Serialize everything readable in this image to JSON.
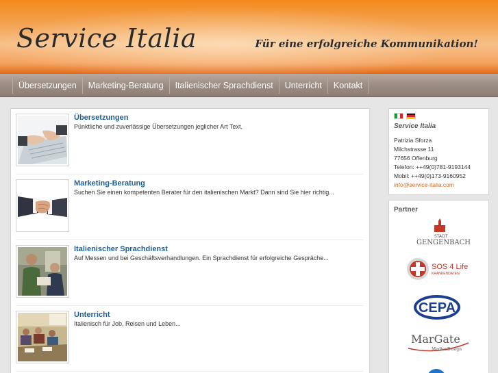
{
  "header": {
    "title": "Service Italia",
    "tagline": "Für eine erfolgreiche Kommunikation!"
  },
  "nav": {
    "items": [
      "Übersetzungen",
      "Marketing-Beratung",
      "Italienischer Sprachdienst",
      "Unterricht",
      "Kontakt"
    ]
  },
  "services": [
    {
      "title": "Übersetzungen",
      "description": "Pünktliche und zuverlässige Übersetzungen  jeglicher Art Text.",
      "image": "typing-hands-photo"
    },
    {
      "title": "Marketing-Beratung",
      "description": "Suchen Sie einen kompetenten Berater für den italienischen Markt? Dann sind Sie hier richtig...",
      "image": "handshake-photo"
    },
    {
      "title": "Italienischer Sprachdienst",
      "description": "Auf Messen und bei Geschäftsverhandlungen. Ein Sprachdienst für erfolgreiche Gespräche...",
      "image": "conversation-photo"
    },
    {
      "title": "Unterricht",
      "description": "Italienisch für Job, Reisen und Leben...",
      "image": "classroom-photo"
    }
  ],
  "contact": {
    "flags": [
      "italy-flag",
      "germany-flag"
    ],
    "title": "Service Italia",
    "name": "Patrizia Sforza",
    "street": "Milchstrasse 11",
    "city": "77656 Offenburg",
    "phone": "Telefon: ++49(0)781-9193144",
    "mobile": "Mobil: ++49(0)173-9160952",
    "email": "info@service-italia.com"
  },
  "partners": {
    "title": "Partner",
    "logos": [
      {
        "top_text": "STADT",
        "text": "GENGENBACH"
      },
      {
        "text": "SOS 4 Life",
        "sub_text": "KRANKENDATEN"
      },
      {
        "text": "CEPA"
      },
      {
        "text": "MarGate",
        "sub_text": "MedienDesign"
      }
    ]
  },
  "colors": {
    "header_orange": "#f58a1e",
    "nav_brown": "#9c8c82",
    "link_blue": "#1d5f94",
    "email_orange": "#d2691e"
  }
}
